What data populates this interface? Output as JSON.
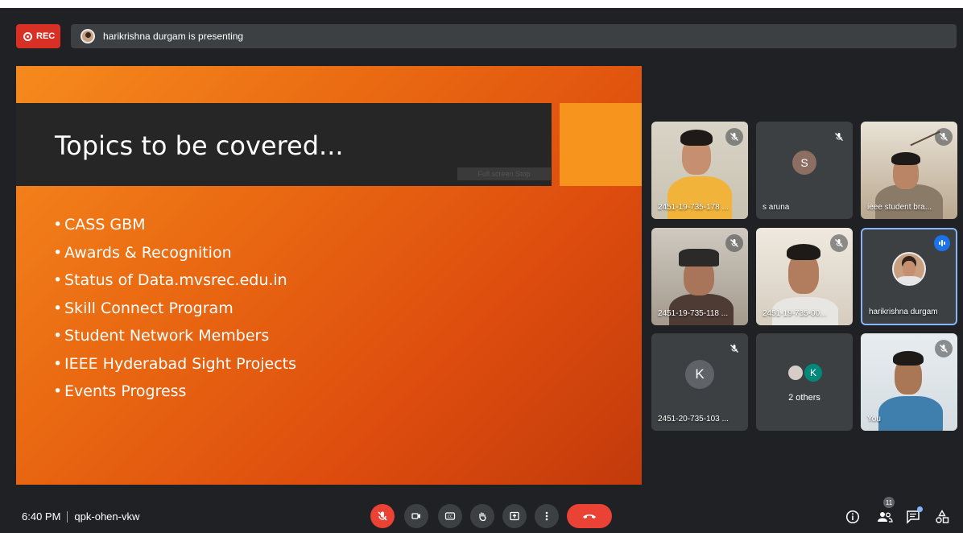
{
  "recording": {
    "label": "REC"
  },
  "presenting_banner": {
    "text": "harikrishna durgam is presenting"
  },
  "slide": {
    "title": "Topics to be covered...",
    "faint_label": "Full screen Stop",
    "bullets": [
      "CASS GBM",
      "Awards & Recognition",
      "Status of Data.mvsrec.edu.in",
      "Skill Connect Program",
      "Student Network Members",
      "IEEE Hyderabad Sight Projects",
      "Events Progress"
    ],
    "colors": {
      "band": "#262626",
      "accent_square": "#f7941d",
      "gradient_start": "#f68a1e",
      "gradient_end": "#c23a0b"
    }
  },
  "participants": [
    {
      "name": "2451-19-735-178 ...",
      "type": "video",
      "muted": true
    },
    {
      "name": "s aruna",
      "type": "letter",
      "letter": "S",
      "avatar_color": "#8d6e63",
      "muted": true
    },
    {
      "name": "ieee student bra...",
      "type": "video",
      "muted": true
    },
    {
      "name": "2451-19-735-118 ...",
      "type": "video",
      "muted": true
    },
    {
      "name": "2451-19-735-00...",
      "type": "video",
      "muted": true
    },
    {
      "name": "harikrishna durgam",
      "type": "photo",
      "muted": false,
      "speaking": true
    },
    {
      "name": "2451-20-735-103 ...",
      "type": "letter",
      "letter": "K",
      "avatar_color": "#5f6368",
      "muted": true
    },
    {
      "name": "2 others",
      "type": "group",
      "letter": "K",
      "avatar_color": "#00897b"
    },
    {
      "name": "You",
      "type": "video",
      "muted": true
    }
  ],
  "footer": {
    "time": "6:40 PM",
    "meeting_code": "qpk-ohen-vkw",
    "people_count": "11"
  },
  "controls": [
    "mic-muted-icon",
    "camera-icon",
    "captions-icon",
    "raise-hand-icon",
    "present-icon",
    "more-options-icon",
    "end-call-icon"
  ],
  "right_controls": [
    "info-icon",
    "people-icon",
    "chat-icon",
    "activities-icon"
  ]
}
